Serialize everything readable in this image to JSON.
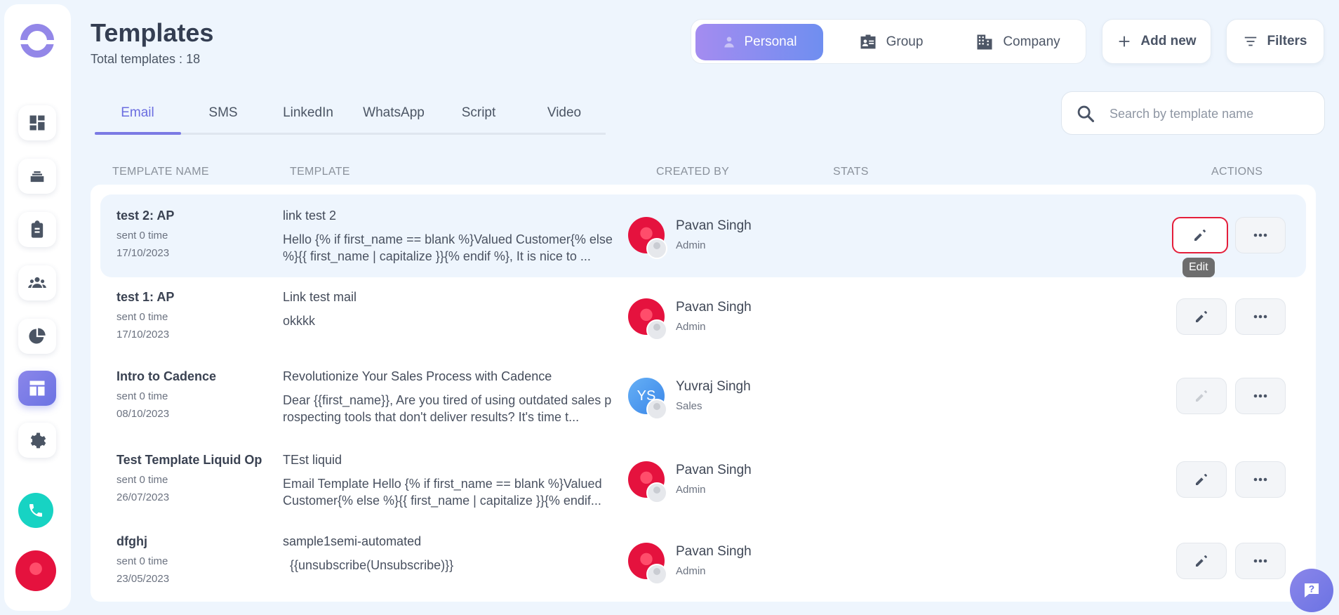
{
  "header": {
    "title": "Templates",
    "subtitle": "Total templates : 18"
  },
  "scope_toggle": {
    "items": [
      {
        "label": "Personal",
        "active": true,
        "icon": "person-icon"
      },
      {
        "label": "Group",
        "active": false,
        "icon": "id-card-icon"
      },
      {
        "label": "Company",
        "active": false,
        "icon": "building-icon"
      }
    ]
  },
  "actions": {
    "add_new": "Add new",
    "filters": "Filters"
  },
  "tabs": [
    {
      "label": "Email",
      "active": true
    },
    {
      "label": "SMS",
      "active": false
    },
    {
      "label": "LinkedIn",
      "active": false
    },
    {
      "label": "WhatsApp",
      "active": false
    },
    {
      "label": "Script",
      "active": false
    },
    {
      "label": "Video",
      "active": false
    }
  ],
  "search": {
    "placeholder": "Search by template name",
    "value": ""
  },
  "table": {
    "columns": [
      "TEMPLATE NAME",
      "TEMPLATE",
      "CREATED BY",
      "STATS",
      "ACTIONS"
    ],
    "rows": [
      {
        "name": "test 2: AP",
        "sent": "sent 0 time",
        "date": "17/10/2023",
        "subject": "link test 2",
        "body": "Hello {% if first_name == blank %}Valued Customer{% else %}{{ first_name | capitalize }}{% endif %}, It is nice to ...",
        "creator": "Pavan Singh",
        "role": "Admin",
        "avatar": "red",
        "edit_state": "focused"
      },
      {
        "name": "test 1: AP",
        "sent": "sent 0 time",
        "date": "17/10/2023",
        "subject": "Link test mail",
        "body": "okkkk",
        "creator": "Pavan Singh",
        "role": "Admin",
        "avatar": "red",
        "edit_state": "normal"
      },
      {
        "name": "Intro to Cadence",
        "sent": "sent 0 time",
        "date": "08/10/2023",
        "subject": "Revolutionize Your Sales Process with Cadence",
        "body": "Dear {{first_name}},   Are you tired of using outdated sales prospecting tools that don't deliver results? It's time t...",
        "creator": "Yuvraj Singh",
        "role": "Sales",
        "avatar": "YS",
        "edit_state": "disabled"
      },
      {
        "name": "Test Template Liquid Op",
        "sent": "sent 0 time",
        "date": "26/07/2023",
        "subject": "TEst liquid",
        "body": "Email Template Hello {% if first_name == blank %}Valued Customer{% else %}{{ first_name | capitalize }}{% endif...",
        "creator": "Pavan Singh",
        "role": "Admin",
        "avatar": "red",
        "edit_state": "normal"
      },
      {
        "name": "dfghj",
        "sent": "sent 0 time",
        "date": "23/05/2023",
        "subject": "sample1semi-automated",
        "body": "  {{unsubscribe(Unsubscribe)}}",
        "creator": "Pavan Singh",
        "role": "Admin",
        "avatar": "red",
        "edit_state": "normal"
      }
    ]
  },
  "tooltip": "Edit",
  "colors": {
    "accent": "#7b7ae4",
    "focus_border": "#e41e3a",
    "call": "#17d3c3"
  }
}
